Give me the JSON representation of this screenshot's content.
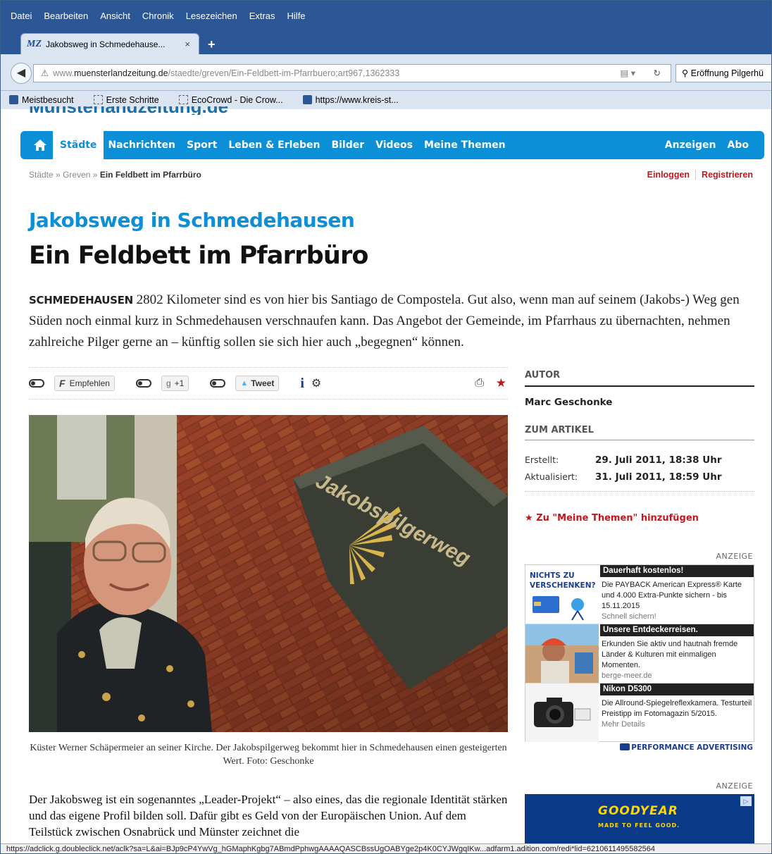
{
  "browser": {
    "menu": [
      "Datei",
      "Bearbeiten",
      "Ansicht",
      "Chronik",
      "Lesezeichen",
      "Extras",
      "Hilfe"
    ],
    "tab_favicon": "MZ",
    "tab_title": "Jakobsweg in Schmedehause...",
    "tab_close": "×",
    "new_tab": "+",
    "url_prefix": "www.",
    "url_domain": "muensterlandzeitung.de",
    "url_path": "/staedte/greven/Ein-Feldbett-im-Pfarrbuero;art967,1362333",
    "search_text": "Eröffnung Pilgerhü",
    "bookmarks": [
      "Meistbesucht",
      "Erste Schritte",
      "EcoCrowd - Die Crow...",
      "https://www.kreis-st..."
    ],
    "status_url": "https://adclick.g.doubleclick.net/aclk?sa=L&ai=BJp9cP4YwVg_hGMaphKgbg7ABmdPphwgAAAAQASCBssUgOABYge2p4K0CYJWgqIKw...adfarm1.adition.com/redi*lid=6210611495582564"
  },
  "site": {
    "logo_text": "Münsterlandzeitung.de",
    "nav": [
      "Städte",
      "Nachrichten",
      "Sport",
      "Leben & Erleben",
      "Bilder",
      "Videos",
      "Meine Themen"
    ],
    "nav_right": [
      "Anzeigen",
      "Abo"
    ],
    "breadcrumb": [
      "Städte",
      "Greven",
      "Ein Feldbett im Pfarrbüro"
    ],
    "breadcrumb_sep": "»",
    "login": "Einloggen",
    "register": "Registrieren"
  },
  "article": {
    "kicker": "Jakobsweg in Schmedehausen",
    "headline": "Ein Feldbett im Pfarrbüro",
    "lead_place": "SCHMEDEHAUSEN",
    "lead_text": " 2802 Kilometer sind es von hier bis Santiago de Compostela. Gut also, wenn man auf seinem (Jakobs-) Weg gen Süden noch einmal kurz in Schmedehausen verschnaufen kann. Das Angebot der Gemeinde, im Pfarrhaus zu übernachten, nehmen zahlreiche Pilger gerne an – künftig sollen sie sich hier auch „begegnen“ können.",
    "share": {
      "facebook": "Empfehlen",
      "gplus": "+1",
      "twitter": "Tweet",
      "info": "i"
    },
    "photo_sign_text": "Jakobspilgerweg",
    "caption": "Küster Werner Schäpermeier an seiner Kirche. Der Jakobspilgerweg bekommt hier in Schmedehausen einen gesteigerten Wert. Foto: Geschonke",
    "body": "Der Jakobsweg ist ein sogenanntes „Leader-Projekt“ – also eines, das die regionale Identität stärken und das eigene Profil bilden soll. Dafür gibt es Geld von der Europäischen Union. Auf dem Teilstück zwischen Osnabrück und Münster zeichnet die"
  },
  "sidebar": {
    "autor_heading": "AUTOR",
    "autor_name": "Marc Geschonke",
    "zum_heading": "ZUM ARTIKEL",
    "created_label": "Erstellt:",
    "created_value": "29. Juli 2011, 18:38 Uhr",
    "updated_label": "Aktualisiert:",
    "updated_value": "31. Juli 2011, 18:59 Uhr",
    "add_theme": "Zu \"Meine Themen\" hinzufügen",
    "anzeige": "ANZEIGE",
    "ads": [
      {
        "img_text": "NICHTS ZU VERSCHENKEN?",
        "title": "Dauerhaft kostenlos!",
        "body": "Die PAYBACK American Express® Karte und 4.000 Extra-Punkte sichern - bis 15.11.2015",
        "link": "Schnell sichern!"
      },
      {
        "img_text": "",
        "title": "Unsere Entdeckerreisen.",
        "body": "Erkunden Sie aktiv und hautnah fremde Länder & Kulturen mit einmaligen Momenten.",
        "link": "berge-meer.de"
      },
      {
        "img_text": "",
        "title": "Nikon D5300",
        "body": "Die Allround-Spiegelreflexkamera. Testurteil Preistipp im Fotomagazin 5/2015.",
        "link": "Mehr Details"
      }
    ],
    "perf": "PERFORMANCE ADVERTISING",
    "goodyear": "GOODYEAR",
    "goodyear_tag": "MADE TO FEEL GOOD."
  },
  "colors": {
    "brand_blue": "#0b8fd6",
    "accent_red": "#c4161c",
    "chrome_blue": "#2b5797"
  }
}
